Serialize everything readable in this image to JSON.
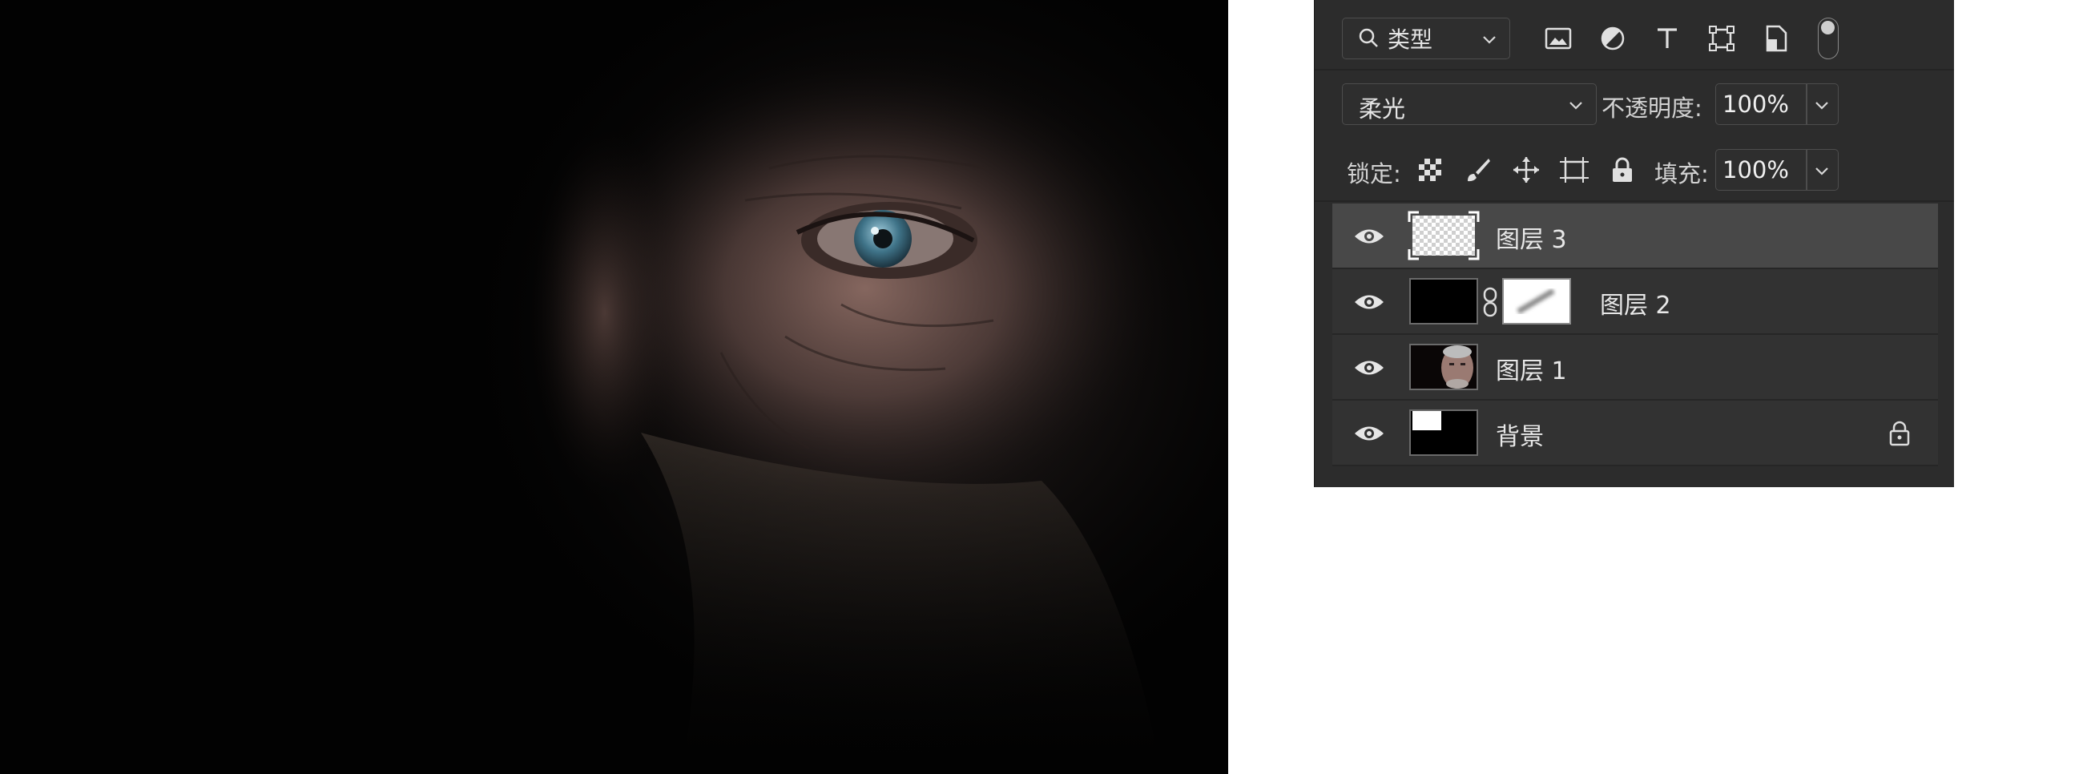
{
  "filter": {
    "label": "类型",
    "icons": [
      "image-icon",
      "adjustment-icon",
      "type-icon",
      "shape-icon",
      "smart-object-icon"
    ]
  },
  "blend": {
    "mode": "柔光",
    "opacity_label": "不透明度:",
    "opacity": "100%"
  },
  "lock": {
    "label": "锁定:",
    "fill_label": "填充:",
    "fill": "100%"
  },
  "layers": [
    {
      "name": "图层 3",
      "selected": true,
      "visible": true
    },
    {
      "name": "图层 2",
      "selected": false,
      "visible": true,
      "has_mask": true
    },
    {
      "name": "图层 1",
      "selected": false,
      "visible": true
    },
    {
      "name": "背景",
      "selected": false,
      "visible": true,
      "locked": true
    }
  ],
  "colors": {
    "panel_bg": "#2c2c2c",
    "row_bg": "#323232",
    "selected_bg": "#484848",
    "text": "#e8e8e8"
  }
}
